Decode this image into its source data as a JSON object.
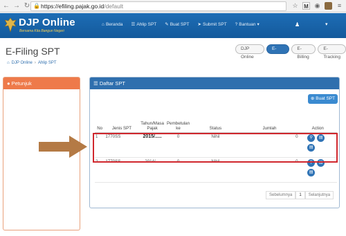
{
  "browser": {
    "url_host": "https://efiling.pajak.go.id",
    "url_path": "/default",
    "ext_m_label": "M"
  },
  "header": {
    "app_title": "DJP Online",
    "tagline": "Bersama Kita Bangun Negeri",
    "nav": [
      {
        "label": "Beranda",
        "icon": "home-icon"
      },
      {
        "label": "Ahlip SPT",
        "icon": "list-icon"
      },
      {
        "label": "Buat SPT",
        "icon": "edit-icon"
      },
      {
        "label": "Submit SPT",
        "icon": "send-icon"
      },
      {
        "label": "Bantuan",
        "icon": "help-icon"
      }
    ]
  },
  "page": {
    "title": "E-Filing SPT",
    "tabs": [
      "DJP Online",
      "E-Filing",
      "E-Billing",
      "E-Tracking"
    ],
    "active_tab": "E-Filing",
    "breadcrumb": [
      "DJP Online",
      "Ahlip SPT"
    ]
  },
  "left_panel": {
    "title": "Petunjuk"
  },
  "main_panel": {
    "title": "Daftar SPT",
    "create_button": "Buat SPT",
    "columns": [
      "No",
      "Jenis SPT",
      "Tahun/Masa Pajak",
      "Pembetulan ke",
      "Status",
      "Jumlah",
      "Action"
    ],
    "rows": [
      {
        "no": "1",
        "jenis": "1770SS",
        "tahun": "2015/.....",
        "pembetulan": "0",
        "status": "Nihil",
        "jumlah": "0"
      },
      {
        "no": "2",
        "jenis": "1770SS",
        "tahun": "2014/---",
        "pembetulan": "0",
        "status": "Nihil",
        "jumlah": "0"
      }
    ],
    "pagination": {
      "prev": "Sebelumnya",
      "current": "1",
      "next": "Selanjutnya"
    }
  },
  "colors": {
    "header_blue": "#1d6db5",
    "panel_orange": "#ee7a4a",
    "highlight_red": "#d0272d",
    "arrow_brown": "#b47a45"
  }
}
